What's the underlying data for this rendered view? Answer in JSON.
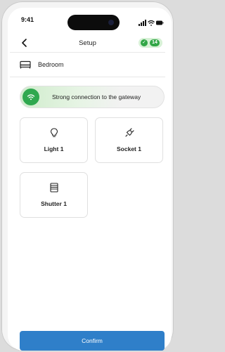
{
  "status_bar": {
    "time": "9:41"
  },
  "nav": {
    "title": "Setup",
    "badge_count": "14"
  },
  "room": {
    "name": "Bedroom"
  },
  "connection": {
    "text": "Strong connection to the gateway",
    "color": "#2fa84f"
  },
  "devices": [
    {
      "label": "Light 1",
      "icon": "lightbulb-icon"
    },
    {
      "label": "Socket 1",
      "icon": "plug-icon"
    },
    {
      "label": "Shutter 1",
      "icon": "shutter-icon"
    }
  ],
  "confirm_button": {
    "label": "Confirm",
    "color": "#2f7fc9"
  }
}
